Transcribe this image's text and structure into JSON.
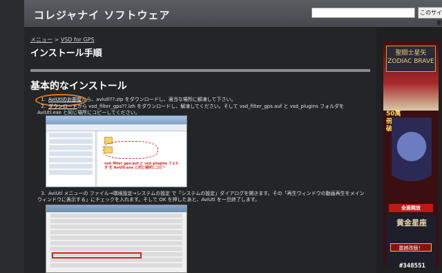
{
  "header": {
    "site_title": "コレジャナイ ソフトウェア",
    "search_placeholder": "",
    "search_button": "このサイトを検索"
  },
  "breadcrumb": {
    "items": [
      "メニュー",
      "VSD for GPS"
    ],
    "separator": ">"
  },
  "page_title": "インストール手順",
  "section_heading": "基本的なインストール",
  "steps": [
    {
      "num": "1.",
      "link": "AviUtlのお部屋",
      "text": "から、aviutl??.zip をダウンロードし、適当な場所に解凍して下さい。"
    },
    {
      "num": "2.",
      "link": "ダウンロード",
      "text": "から vsd_filter_gps??.lzh をダウンロードし、解凍してください。そして vsd_filter_gps.auf と vsd_plugins フォルダを AviUtl.exe と同じ場所にコピーしてください。"
    },
    {
      "num": "3.",
      "text": "AviUtl メニューの ファイル→環境設定→システムの設定 で「システムの設定」ダイアログを開きます。その「再生ウィンドウの動画再生をメインウィンドウに表示する」にチェックを入れます。そして OK を押したあと、AviUtl を一旦終了します。"
    }
  ],
  "screenshot1": {
    "note": "vsd_filter_gps.auf と vsd_plugins フォルダ を AviUtl.exe と同じ場所にコピー"
  },
  "ad": {
    "logo_text": "聖闘士星矢 ZODIAC BRAVE",
    "promo_text": "50萬冊突破",
    "badge": "全面開放",
    "title2": "黄金星座",
    "cta": "震撼改版！"
  },
  "watermark": "#348551"
}
